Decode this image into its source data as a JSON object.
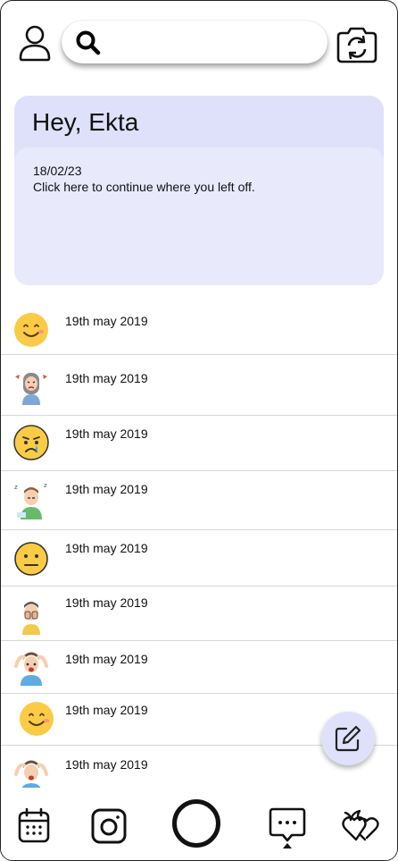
{
  "header": {
    "profile_icon": "user-icon",
    "search_icon": "search-icon",
    "search_placeholder": "",
    "camera_icon": "camera-rotate-icon"
  },
  "greeting": {
    "title": "Hey, Ekta",
    "last_date": "18/02/23",
    "continue_text": "Click here to continue where you left off."
  },
  "entries": [
    {
      "date": "19th may 2019",
      "mood_icon": "smiling-face-icon"
    },
    {
      "date": "19th may 2019",
      "mood_icon": "angry-woman-icon"
    },
    {
      "date": "19th may 2019",
      "mood_icon": "crying-face-icon"
    },
    {
      "date": "19th may 2019",
      "mood_icon": "sleepy-man-icon"
    },
    {
      "date": "19th may 2019",
      "mood_icon": "neutral-face-icon"
    },
    {
      "date": "19th may 2019",
      "mood_icon": "facepalm-man-icon"
    },
    {
      "date": "19th may 2019",
      "mood_icon": "stressed-man-icon"
    },
    {
      "date": "19th may 2019",
      "mood_icon": "smiling-face-icon"
    },
    {
      "date": "19th may 2019",
      "mood_icon": "stressed-man-icon"
    }
  ],
  "fab": {
    "icon": "edit-icon"
  },
  "nav": [
    {
      "icon": "calendar-icon"
    },
    {
      "icon": "camera-icon"
    },
    {
      "icon": "record-circle-icon"
    },
    {
      "icon": "chat-icon"
    },
    {
      "icon": "hearts-flame-icon"
    }
  ],
  "colors": {
    "card_bg": "#dfe1fb",
    "card_inner": "#e8e9fb",
    "emoji_yellow": "#fbcb45",
    "separator": "#d7d7db"
  }
}
